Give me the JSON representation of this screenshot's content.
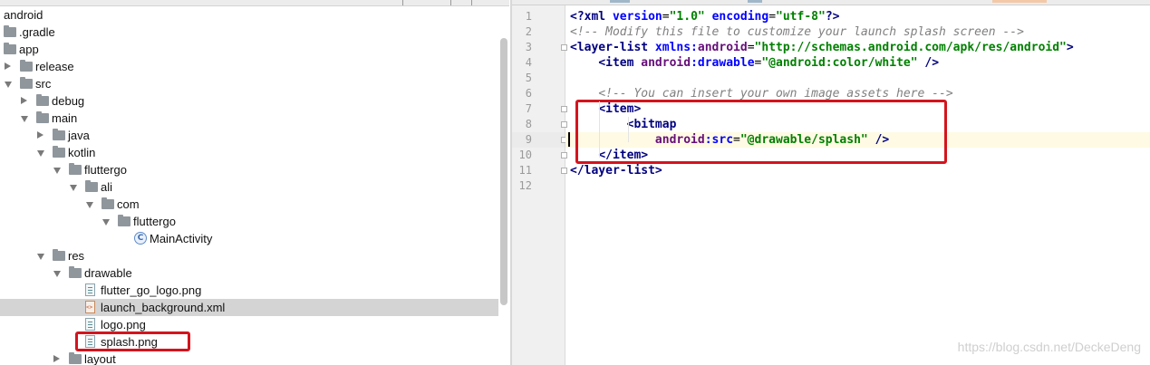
{
  "project_tree": {
    "items": [
      {
        "label": "android",
        "depth": 0,
        "kind": "module",
        "state": "none"
      },
      {
        "label": ".gradle",
        "depth": 0,
        "kind": "folder",
        "state": "none"
      },
      {
        "label": "app",
        "depth": 0,
        "kind": "folder",
        "state": "none"
      },
      {
        "label": "release",
        "depth": 0,
        "kind": "folder",
        "state": "collapsed"
      },
      {
        "label": "src",
        "depth": 0,
        "kind": "folder",
        "state": "expanded"
      },
      {
        "label": "debug",
        "depth": 1,
        "kind": "folder",
        "state": "collapsed"
      },
      {
        "label": "main",
        "depth": 1,
        "kind": "folder",
        "state": "expanded"
      },
      {
        "label": "java",
        "depth": 2,
        "kind": "folder",
        "state": "collapsed"
      },
      {
        "label": "kotlin",
        "depth": 2,
        "kind": "folder",
        "state": "expanded"
      },
      {
        "label": "fluttergo",
        "depth": 3,
        "kind": "folder",
        "state": "expanded"
      },
      {
        "label": "ali",
        "depth": 4,
        "kind": "folder",
        "state": "expanded"
      },
      {
        "label": "com",
        "depth": 5,
        "kind": "folder",
        "state": "expanded"
      },
      {
        "label": "fluttergo",
        "depth": 6,
        "kind": "folder",
        "state": "expanded"
      },
      {
        "label": "MainActivity",
        "depth": 7,
        "kind": "kotlin",
        "state": "none"
      },
      {
        "label": "res",
        "depth": 2,
        "kind": "folder",
        "state": "expanded"
      },
      {
        "label": "drawable",
        "depth": 3,
        "kind": "folder",
        "state": "expanded"
      },
      {
        "label": "flutter_go_logo.png",
        "depth": 4,
        "kind": "png",
        "state": "none"
      },
      {
        "label": "launch_background.xml",
        "depth": 4,
        "kind": "xml",
        "state": "none",
        "selected": true
      },
      {
        "label": "logo.png",
        "depth": 4,
        "kind": "png",
        "state": "none"
      },
      {
        "label": "splash.png",
        "depth": 4,
        "kind": "png",
        "state": "none",
        "highlighted": true
      },
      {
        "label": "layout",
        "depth": 3,
        "kind": "folder",
        "state": "collapsed"
      }
    ]
  },
  "editor": {
    "current_line": 9,
    "lines": [
      {
        "n": "1",
        "tokens": [
          [
            "tag",
            "<?xml "
          ],
          [
            "attr",
            "version"
          ],
          [
            "plain",
            "="
          ],
          [
            "val",
            "\"1.0\""
          ],
          [
            "plain",
            " "
          ],
          [
            "attr",
            "encoding"
          ],
          [
            "plain",
            "="
          ],
          [
            "val",
            "\"utf-8\""
          ],
          [
            "tag",
            "?>"
          ]
        ]
      },
      {
        "n": "2",
        "tokens": [
          [
            "cm",
            "<!-- Modify this file to customize your launch splash screen -->"
          ]
        ]
      },
      {
        "n": "3",
        "tokens": [
          [
            "tag",
            "<layer-list "
          ],
          [
            "attr",
            "xmlns:"
          ],
          [
            "ns",
            "android"
          ],
          [
            "plain",
            "="
          ],
          [
            "val",
            "\"http://schemas.android.com/apk/res/android\""
          ],
          [
            "tag",
            ">"
          ]
        ]
      },
      {
        "n": "4",
        "tokens": [
          [
            "plain",
            "    "
          ],
          [
            "tag",
            "<item "
          ],
          [
            "ns",
            "android"
          ],
          [
            "attr",
            ":drawable"
          ],
          [
            "plain",
            "="
          ],
          [
            "val",
            "\"@android:color/white\""
          ],
          [
            "plain",
            " "
          ],
          [
            "tag",
            "/>"
          ]
        ]
      },
      {
        "n": "5",
        "tokens": []
      },
      {
        "n": "6",
        "tokens": [
          [
            "plain",
            "    "
          ],
          [
            "cm",
            "<!-- You can insert your own image assets here -->"
          ]
        ]
      },
      {
        "n": "7",
        "tokens": [
          [
            "plain",
            "    "
          ],
          [
            "tag",
            "<item>"
          ]
        ]
      },
      {
        "n": "8",
        "tokens": [
          [
            "plain",
            "        "
          ],
          [
            "tag",
            "<bitmap"
          ]
        ]
      },
      {
        "n": "9",
        "tokens": [
          [
            "plain",
            "            "
          ],
          [
            "ns",
            "android"
          ],
          [
            "attr",
            ":src"
          ],
          [
            "plain",
            "="
          ],
          [
            "val",
            "\"@drawable/splash\""
          ],
          [
            "plain",
            " "
          ],
          [
            "tag",
            "/>"
          ]
        ]
      },
      {
        "n": "10",
        "tokens": [
          [
            "plain",
            "    "
          ],
          [
            "tag",
            "</item>"
          ]
        ]
      },
      {
        "n": "11",
        "tokens": [
          [
            "tag",
            "</layer-list>"
          ]
        ]
      },
      {
        "n": "12",
        "tokens": []
      }
    ]
  },
  "colors": {
    "highlight_box": "#d4141d",
    "selection": "#d4d4d4",
    "current_line": "#fffae3"
  },
  "icons": [
    "folder-icon",
    "png-file-icon",
    "xml-file-icon",
    "kotlin-class-icon",
    "expand-arrow-icon",
    "collapse-arrow-icon"
  ],
  "watermark": "https://blog.csdn.net/DeckeDeng"
}
